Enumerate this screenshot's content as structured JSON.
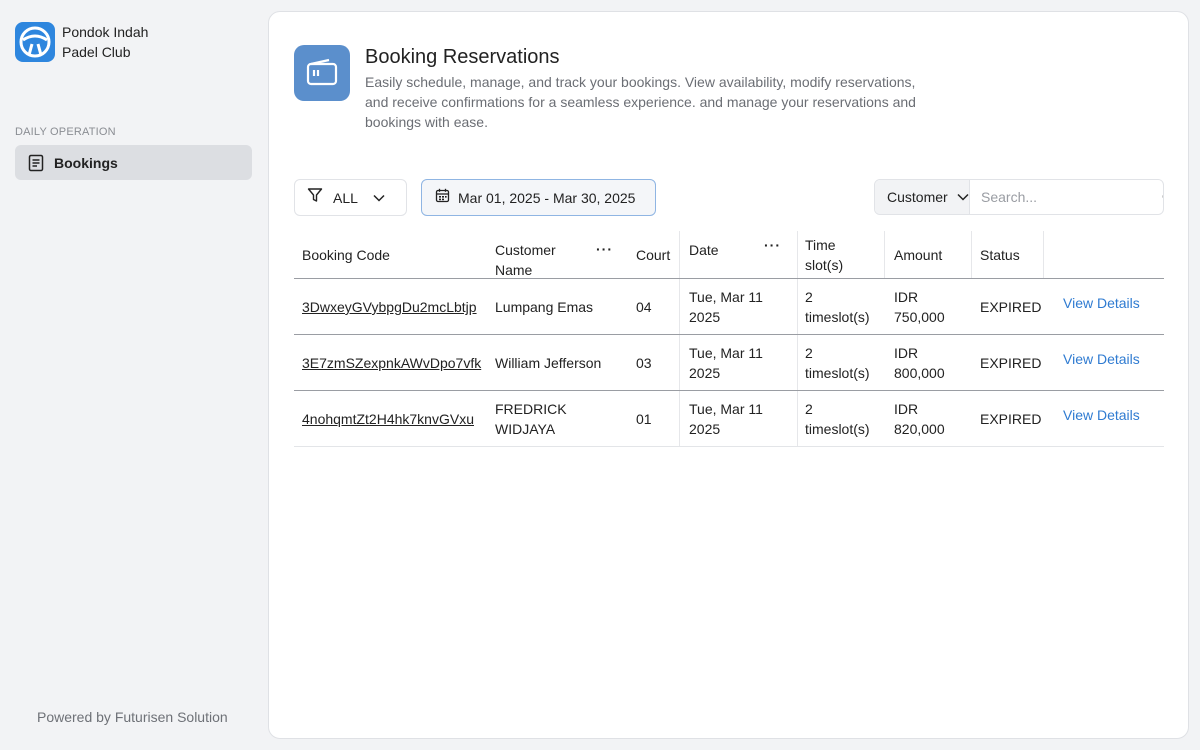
{
  "brand": {
    "name": "Pondok Indah Padel Club"
  },
  "sidebar": {
    "section_label": "DAILY OPERATION",
    "items": [
      {
        "label": "Bookings",
        "icon": "document-icon",
        "active": true
      }
    ],
    "footer": "Powered by Futurisen Solution"
  },
  "header": {
    "title": "Booking Reservations",
    "description": "Easily schedule, manage, and track your bookings. View availability, modify reservations, and receive confirmations for a seamless experience. and manage your reservations and bookings with ease."
  },
  "toolbar": {
    "filter_label": "ALL",
    "date_range": "Mar 01, 2025 - Mar 30, 2025",
    "search_field": "Customer",
    "search_placeholder": "Search..."
  },
  "table": {
    "headers": {
      "code": "Booking Code",
      "customer": "Customer Name",
      "court": "Court",
      "date": "Date",
      "timeslot": "Time slot(s)",
      "amount": "Amount",
      "status": "Status"
    },
    "rows": [
      {
        "code": "3DwxeyGVybpgDu2mcLbtjp",
        "customer": "Lumpang Emas",
        "court": "04",
        "date": "Tue, Mar 11 2025",
        "timeslot": "2 timeslot(s)",
        "amount": "IDR 750,000",
        "status": "EXPIRED",
        "action": "View Details"
      },
      {
        "code": "3E7zmSZexpnkAWvDpo7vfk",
        "customer": "William Jefferson",
        "court": "03",
        "date": "Tue, Mar 11 2025",
        "timeslot": "2 timeslot(s)",
        "amount": "IDR 800,000",
        "status": "EXPIRED",
        "action": "View Details"
      },
      {
        "code": "4nohqmtZt2H4hk7knvGVxu",
        "customer": "FREDRICK WIDJAYA",
        "court": "01",
        "date": "Tue, Mar 11 2025",
        "timeslot": "2 timeslot(s)",
        "amount": "IDR 820,000",
        "status": "EXPIRED",
        "action": "View Details"
      }
    ]
  },
  "colors": {
    "accent": "#2e86de",
    "link": "#2f7bd1",
    "header_icon_bg": "#5b8fcc"
  }
}
